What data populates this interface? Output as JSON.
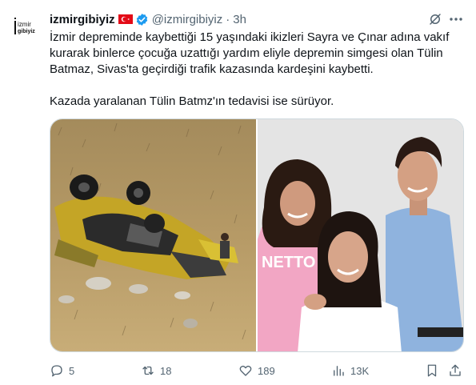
{
  "tweet": {
    "author": {
      "display_name": "izmirgibiyiz",
      "handle": "@izmirgibiyiz",
      "time": "3h",
      "avatar_lines": [
        "izmir",
        "gibiyiz"
      ]
    },
    "text_paragraphs": [
      "İzmir depreminde kaybettiği 15 yaşındaki ikizleri Sayra ve Çınar adına vakıf kurarak binlerce çocuğa uzattığı yardım eliyle depremin simgesi olan Tülin Batmaz, Sivas'ta geçirdiği trafik kazasında kardeşini kaybetti.",
      "Kazada yaralanan Tülin Batmz'ın tedavisi ise sürüyor."
    ],
    "media": {
      "right_shirt_text": "NETTO"
    },
    "actions": {
      "replies": "5",
      "reposts": "18",
      "likes": "189",
      "views": "13K"
    },
    "icons": [
      "verified-badge-icon",
      "turkey-flag-icon",
      "grok-icon",
      "more-icon",
      "reply-icon",
      "repost-icon",
      "like-icon",
      "views-icon",
      "bookmark-icon",
      "share-icon"
    ],
    "colors": {
      "text": "#0f1419",
      "secondary": "#536471",
      "verified": "#1d9bf0",
      "flag": "#e30a17"
    }
  }
}
